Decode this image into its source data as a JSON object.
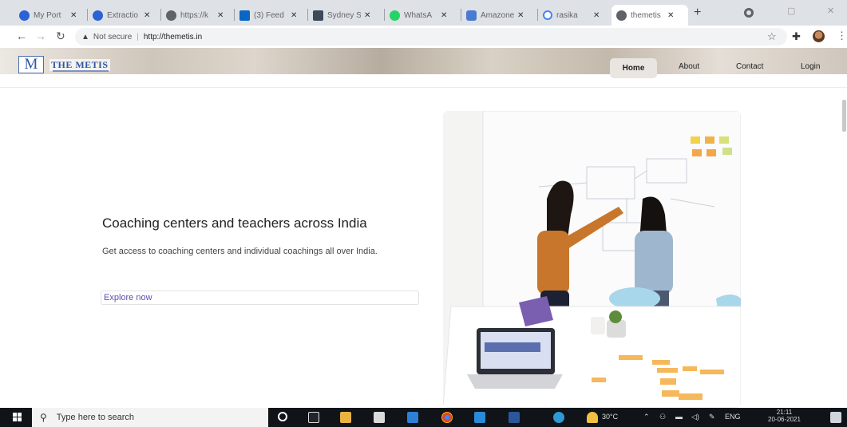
{
  "browser": {
    "tabs": [
      {
        "label": "My Port",
        "fav_color": "#2b63d6"
      },
      {
        "label": "Extractio",
        "fav_color": "#2b63d6"
      },
      {
        "label": "https://k",
        "fav_color": "#5f6368"
      },
      {
        "label": "(3) Feed",
        "fav_color": "#0a66c2"
      },
      {
        "label": "Sydney S",
        "fav_color": "#3d4a5c"
      },
      {
        "label": "WhatsA",
        "fav_color": "#25d366"
      },
      {
        "label": "Amazone",
        "fav_color": "#4a7bd0"
      },
      {
        "label": "rasika",
        "fav_color": "#4285f4"
      },
      {
        "label": "themetis",
        "fav_color": "#5f6368",
        "active": true
      }
    ],
    "address": {
      "security_label": "Not secure",
      "url": "http://themetis.in"
    }
  },
  "site": {
    "logo_mark": "M",
    "logo_text": "THE METIS",
    "nav": {
      "home": "Home",
      "about": "About",
      "contact": "Contact",
      "login": "Login"
    },
    "hero": {
      "title": "Coaching centers and teachers across India",
      "subtitle": "Get access to coaching centers and individual coachings all over India.",
      "cta": "Explore now"
    }
  },
  "taskbar": {
    "search_placeholder": "Type here to search",
    "weather": "30°C",
    "language": "ENG",
    "time": "21:11",
    "date": "20-06-2021"
  }
}
